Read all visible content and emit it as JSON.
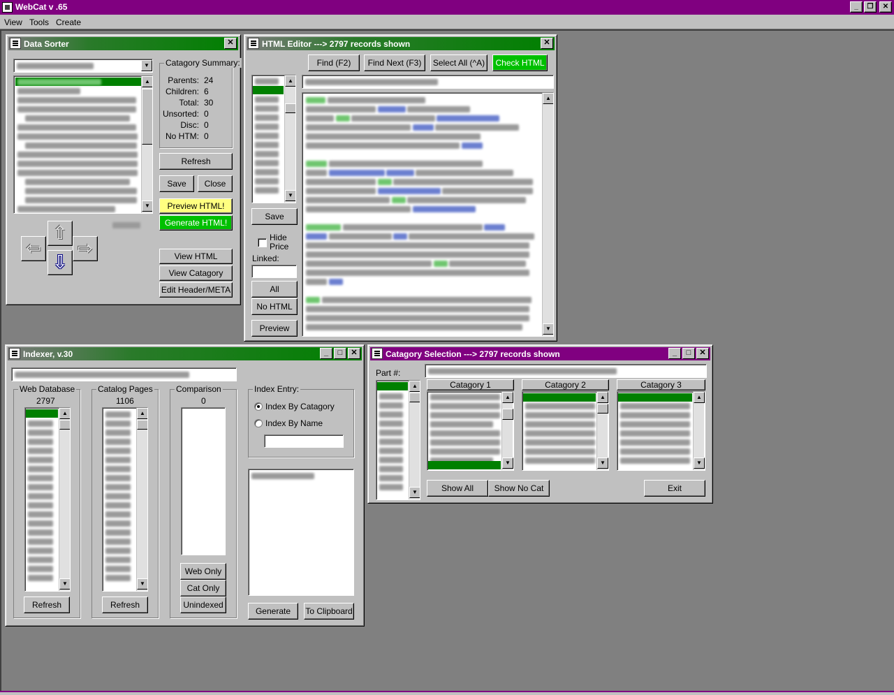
{
  "app": {
    "title": "WebCat v .65"
  },
  "menu": [
    "View",
    "Tools",
    "Create"
  ],
  "data_sorter": {
    "title": "Data Sorter",
    "summary_label": "Catagory Summary:",
    "stats": [
      {
        "label": "Parents:",
        "value": "24"
      },
      {
        "label": "Children:",
        "value": "6"
      },
      {
        "label": "Total:",
        "value": "30"
      },
      {
        "label": "Unsorted:",
        "value": "0"
      },
      {
        "label": "Disc:",
        "value": "0"
      },
      {
        "label": "No HTM:",
        "value": "0"
      }
    ],
    "buttons": {
      "refresh": "Refresh",
      "save": "Save",
      "close": "Close",
      "preview": "Preview HTML!",
      "generate": "Generate HTML!",
      "view_html": "View HTML",
      "view_category": "View Catagory",
      "edit_header": "Edit Header/META"
    }
  },
  "html_editor": {
    "title": "HTML Editor ---> 2797 records shown",
    "buttons": {
      "find": "Find (F2)",
      "find_next": "Find Next (F3)",
      "select_all": "Select All (^A)",
      "check_html": "Check HTML",
      "save": "Save",
      "all": "All",
      "no_html": "No HTML",
      "preview": "Preview"
    },
    "hide_price": "Hide Price",
    "linked_label": "Linked:"
  },
  "indexer": {
    "title": "Indexer, v.30",
    "web_db": {
      "label": "Web Database",
      "count": "2797",
      "refresh": "Refresh"
    },
    "catalog": {
      "label": "Catalog Pages",
      "count": "1106",
      "refresh": "Refresh"
    },
    "comparison": {
      "label": "Comparison",
      "count": "0",
      "web_only": "Web Only",
      "cat_only": "Cat Only",
      "unindexed": "Unindexed"
    },
    "index_entry": {
      "label": "Index Entry:",
      "by_category": "Index By Catagory",
      "by_name": "Index By Name"
    },
    "generate": "Generate",
    "clipboard": "To Clipboard"
  },
  "category_selection": {
    "title": "Catagory Selection ---> 2797 records shown",
    "part_label": "Part #:",
    "columns": [
      "Catagory 1",
      "Catagory 2",
      "Catagory 3"
    ],
    "show_all": "Show All",
    "show_no_cat": "Show No Cat",
    "exit": "Exit"
  }
}
